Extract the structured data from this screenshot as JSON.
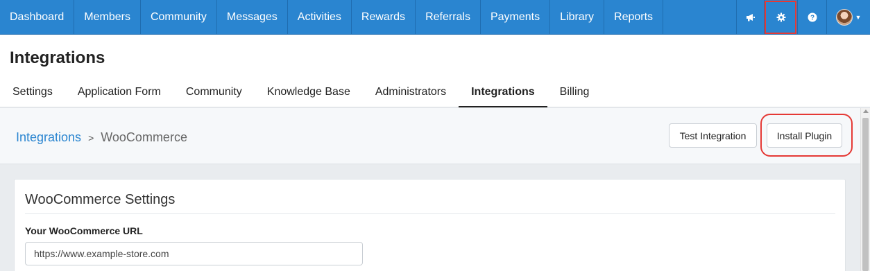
{
  "topnav": {
    "items": [
      "Dashboard",
      "Members",
      "Community",
      "Messages",
      "Activities",
      "Rewards",
      "Referrals",
      "Payments",
      "Library",
      "Reports"
    ],
    "icons": {
      "announce": "megaphone-icon",
      "settings": "gear-icon",
      "help": "question-icon",
      "user": "avatar"
    }
  },
  "page": {
    "title": "Integrations",
    "tabs": [
      {
        "label": "Settings",
        "active": false
      },
      {
        "label": "Application Form",
        "active": false
      },
      {
        "label": "Community",
        "active": false
      },
      {
        "label": "Knowledge Base",
        "active": false
      },
      {
        "label": "Administrators",
        "active": false
      },
      {
        "label": "Integrations",
        "active": true
      },
      {
        "label": "Billing",
        "active": false
      }
    ]
  },
  "breadcrumb": {
    "parent": "Integrations",
    "separator": ">",
    "current": "WooCommerce"
  },
  "actions": {
    "test_label": "Test Integration",
    "install_label": "Install Plugin"
  },
  "settings_card": {
    "title": "WooCommerce Settings",
    "url_label": "Your WooCommerce URL",
    "url_value": "https://www.example-store.com"
  },
  "colors": {
    "nav_bg": "#2a85d0",
    "highlight": "#e53935",
    "link": "#2a85d0"
  }
}
